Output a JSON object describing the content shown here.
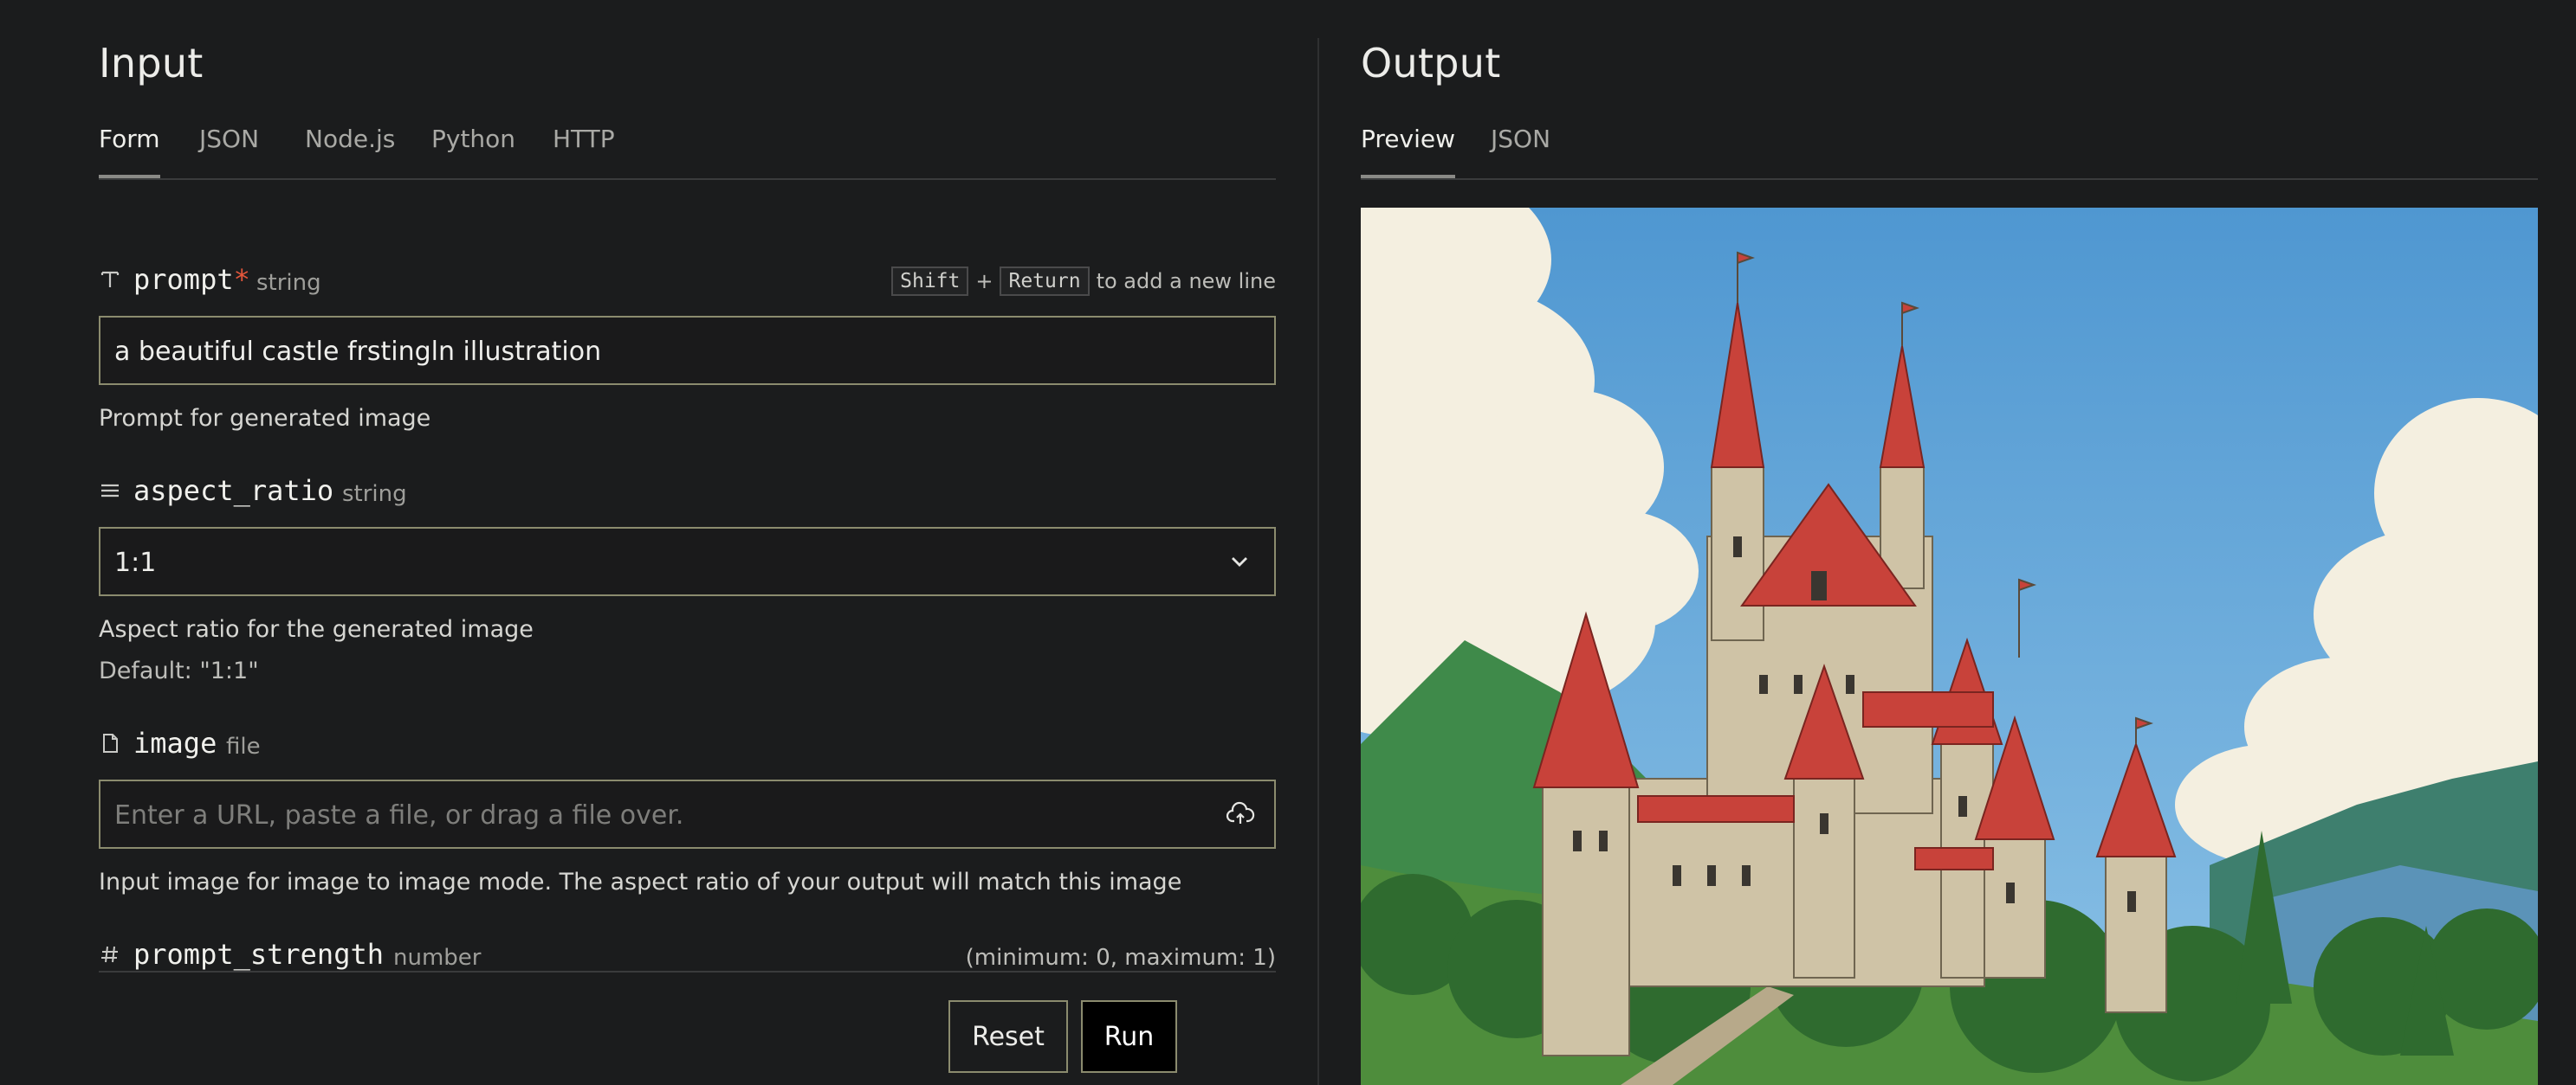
{
  "input": {
    "title": "Input",
    "tabs": [
      "Form",
      "JSON",
      "Node.js",
      "Python",
      "HTTP"
    ],
    "fields": {
      "prompt": {
        "name": "prompt",
        "required_mark": "*",
        "type": "string",
        "kbd_hint": {
          "key1": "Shift",
          "plus": "+",
          "key2": "Return",
          "suffix": "to add a new line"
        },
        "value": "a beautiful castle frstingln illustration",
        "description": "Prompt for generated image"
      },
      "aspect_ratio": {
        "name": "aspect_ratio",
        "type": "string",
        "value": "1:1",
        "description": "Aspect ratio for the generated image",
        "default_text": "Default: \"1:1\""
      },
      "image": {
        "name": "image",
        "type": "file",
        "placeholder": "Enter a URL, paste a file, or drag a file over.",
        "description": "Input image for image to image mode. The aspect ratio of your output will match this image"
      },
      "prompt_strength": {
        "name": "prompt_strength",
        "type": "number",
        "range": "(minimum: 0, maximum: 1)"
      }
    },
    "buttons": {
      "reset": "Reset",
      "run": "Run"
    }
  },
  "output": {
    "title": "Output",
    "tabs": [
      "Preview",
      "JSON"
    ],
    "image_icon": "castle-illustration"
  },
  "colors": {
    "background": "#1b1c1d",
    "input_border": "#8b8b6e",
    "required": "#e2563b",
    "sky": "#5ea3d6",
    "roof": "#c8423a"
  }
}
